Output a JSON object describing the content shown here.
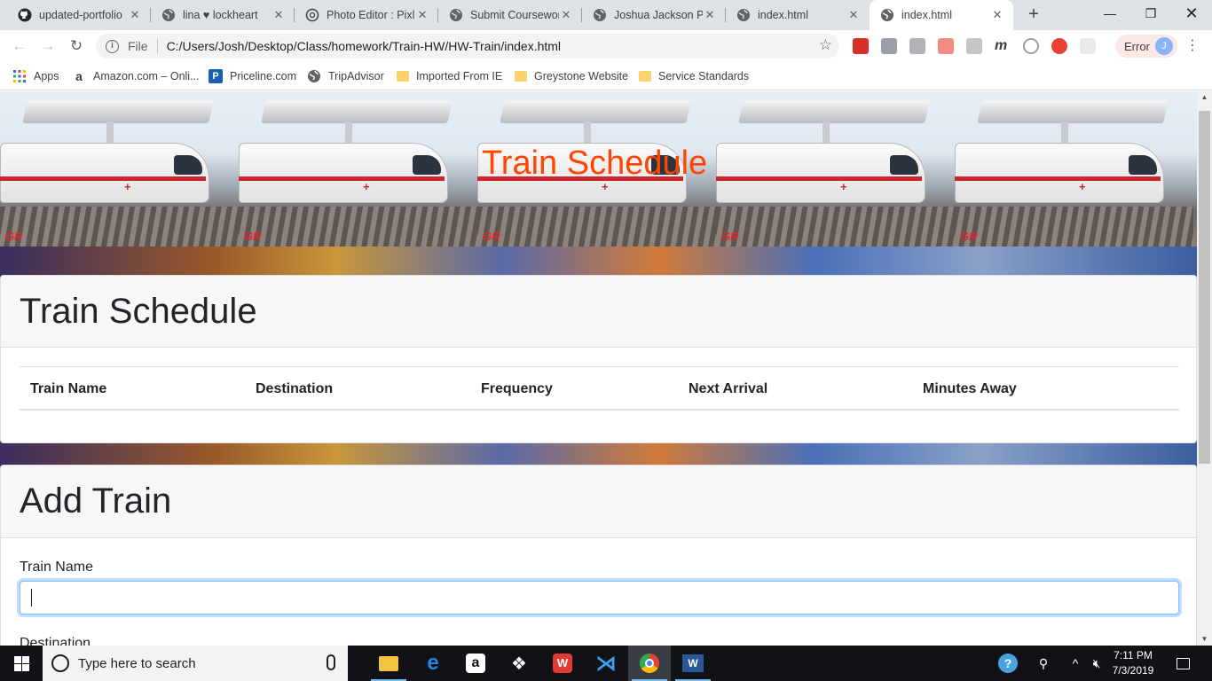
{
  "browser": {
    "tabs": [
      {
        "title": "updated-portfolio",
        "icon": "github-icon"
      },
      {
        "title": "lina ♥ lockheart",
        "icon": "globe-icon"
      },
      {
        "title": "Photo Editor : Pixlr",
        "icon": "aperture-icon"
      },
      {
        "title": "Submit Coursework",
        "icon": "globe-icon"
      },
      {
        "title": "Joshua Jackson Po",
        "icon": "globe-icon"
      },
      {
        "title": "index.html",
        "icon": "globe-icon"
      },
      {
        "title": "index.html",
        "icon": "globe-icon",
        "active": true
      }
    ],
    "address": {
      "scheme": "File",
      "url": "C:/Users/Josh/Desktop/Class/homework/Train-HW/HW-Train/index.html"
    },
    "profile_status": "Error",
    "profile_initial": "J",
    "bookmarks": [
      "Apps",
      "Amazon.com – Onli...",
      "Priceline.com",
      "TripAdvisor",
      "Imported From IE",
      "Greystone Website",
      "Service Standards"
    ]
  },
  "page": {
    "jumbotron_title": "Train Schedule",
    "schedule": {
      "heading": "Train Schedule",
      "columns": [
        "Train Name",
        "Destination",
        "Frequency",
        "Next Arrival",
        "Minutes Away"
      ]
    },
    "add_train": {
      "heading": "Add Train",
      "fields": [
        "Train Name",
        "Destination"
      ],
      "train_name_value": ""
    },
    "logo_text": "GR"
  },
  "taskbar": {
    "search_placeholder": "Type here to search",
    "time": "7:11 PM",
    "date": "7/3/2019"
  },
  "colors": {
    "jumbotron_title": "#ff4500",
    "focus_ring": "#80bdff"
  }
}
